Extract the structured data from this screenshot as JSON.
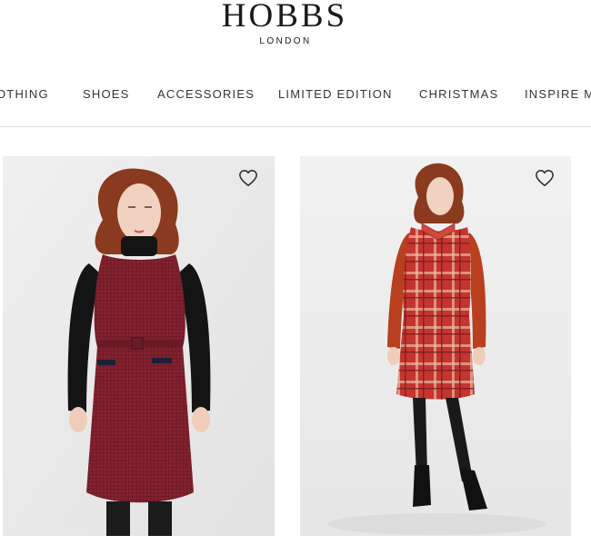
{
  "header": {
    "brand_name": "HOBBS",
    "brand_sub": "LONDON"
  },
  "nav": {
    "items": [
      {
        "label": "OTHING"
      },
      {
        "label": "SHOES"
      },
      {
        "label": "ACCESSORIES"
      },
      {
        "label": "LIMITED EDITION"
      },
      {
        "label": "CHRISTMAS"
      },
      {
        "label": "INSPIRE M"
      }
    ]
  },
  "products": [
    {
      "image": "red-tweed-pinafore-dress-over-black-turtleneck",
      "wishlist_icon": "heart-outline-icon"
    },
    {
      "image": "red-check-collared-shift-dress",
      "wishlist_icon": "heart-outline-icon"
    }
  ],
  "colors": {
    "text": "#1a1a1a",
    "divider": "#dedede",
    "card_bg": "#ececec",
    "dress_burgundy": "#7d1f2c",
    "check_red": "#c0342f"
  }
}
